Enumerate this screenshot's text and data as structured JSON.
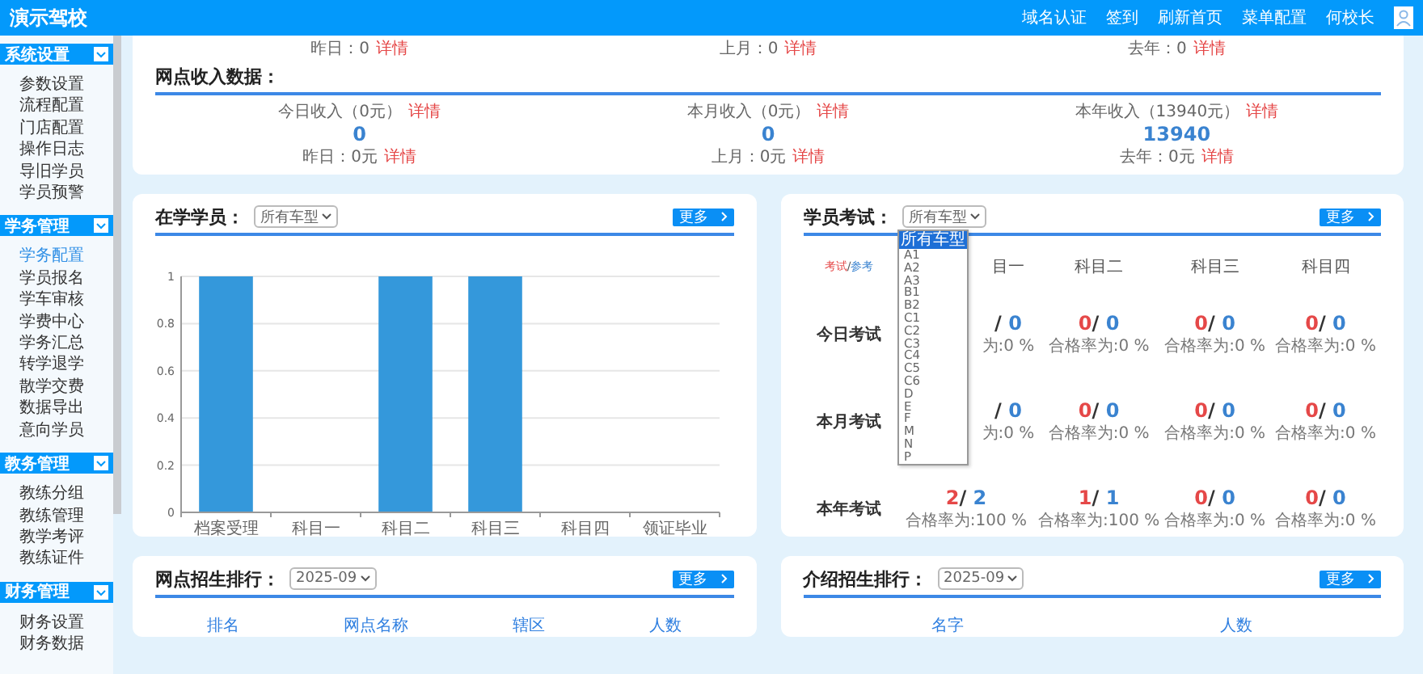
{
  "app": {
    "title": "演示驾校"
  },
  "top_nav": [
    {
      "label": "域名认证"
    },
    {
      "label": "签到"
    },
    {
      "label": "刷新首页"
    },
    {
      "label": "菜单配置"
    }
  ],
  "user": {
    "name": "何校长"
  },
  "sidebar": {
    "sections": [
      {
        "title": "系统设置",
        "expanded": true,
        "items": [
          {
            "label": "参数设置",
            "selected": false
          },
          {
            "label": "流程配置",
            "selected": false
          },
          {
            "label": "门店配置",
            "selected": false
          },
          {
            "label": "操作日志",
            "selected": false
          },
          {
            "label": "导旧学员",
            "selected": false
          },
          {
            "label": "学员预警",
            "selected": false
          }
        ]
      },
      {
        "title": "学务管理",
        "expanded": true,
        "items": [
          {
            "label": "学务配置",
            "selected": true
          },
          {
            "label": "学员报名",
            "selected": false
          },
          {
            "label": "学车审核",
            "selected": false
          },
          {
            "label": "学费中心",
            "selected": false
          },
          {
            "label": "学务汇总",
            "selected": false
          },
          {
            "label": "转学退学",
            "selected": false
          },
          {
            "label": "散学交费",
            "selected": false
          },
          {
            "label": "数据导出",
            "selected": false
          },
          {
            "label": "意向学员",
            "selected": false
          }
        ]
      },
      {
        "title": "教务管理",
        "expanded": true,
        "items": [
          {
            "label": "教练分组",
            "selected": false
          },
          {
            "label": "教练管理",
            "selected": false
          },
          {
            "label": "教学考评",
            "selected": false
          },
          {
            "label": "教练证件",
            "selected": false
          }
        ]
      },
      {
        "title": "财务管理",
        "expanded": true,
        "items": [
          {
            "label": "财务设置",
            "selected": false
          },
          {
            "label": "财务数据",
            "selected": false
          }
        ]
      }
    ]
  },
  "summary": {
    "prev_stats": [
      {
        "label": "昨日：0",
        "link": "详情"
      },
      {
        "label": "上月：0",
        "link": "详情"
      },
      {
        "label": "去年：0",
        "link": "详情"
      }
    ],
    "income": {
      "title": "网点收入数据：",
      "stats": [
        {
          "label": "今日收入（0元）",
          "link": "详情",
          "value": "0",
          "prev": "昨日：0元",
          "prev_link": "详情"
        },
        {
          "label": "本月收入（0元）",
          "link": "详情",
          "value": "0",
          "prev": "上月：0元",
          "prev_link": "详情"
        },
        {
          "label": "本年收入（13940元）",
          "link": "详情",
          "value": "13940",
          "prev": "去年：0元",
          "prev_link": "详情"
        }
      ]
    }
  },
  "students_card": {
    "title": "在学学员：",
    "filter": "所有车型",
    "more": "更多",
    "chart_data": {
      "type": "bar",
      "categories": [
        "档案受理",
        "科目一",
        "科目二",
        "科目三",
        "科目四",
        "领证毕业"
      ],
      "series": [
        {
          "color": "#3498db",
          "values": [
            1,
            0,
            1,
            1,
            0,
            0
          ]
        }
      ],
      "grid": true,
      "ylim": [
        0,
        1
      ],
      "yticks": [
        0,
        0.2,
        0.4,
        0.6,
        0.8,
        1
      ]
    }
  },
  "exam_card": {
    "title": "学员考试：",
    "filter": "所有车型",
    "more": "更多",
    "dropdown": {
      "options": [
        {
          "label": "所有车型",
          "selected": true
        },
        {
          "label": "A1",
          "selected": false
        },
        {
          "label": "A2",
          "selected": false
        },
        {
          "label": "A3",
          "selected": false
        },
        {
          "label": "B1",
          "selected": false
        },
        {
          "label": "B2",
          "selected": false
        },
        {
          "label": "C1",
          "selected": false
        },
        {
          "label": "C2",
          "selected": false
        },
        {
          "label": "C3",
          "selected": false
        },
        {
          "label": "C4",
          "selected": false
        },
        {
          "label": "C5",
          "selected": false
        },
        {
          "label": "C6",
          "selected": false
        },
        {
          "label": "D",
          "selected": false
        },
        {
          "label": "E",
          "selected": false
        },
        {
          "label": "F",
          "selected": false
        },
        {
          "label": "M",
          "selected": false
        },
        {
          "label": "N",
          "selected": false
        },
        {
          "label": "P",
          "selected": false
        }
      ]
    },
    "legend": {
      "exam": "考试",
      "separator": "/",
      "reference": "参考"
    },
    "subjects": [
      "目一",
      "科目二",
      "科目三",
      "科目四"
    ],
    "rows": [
      {
        "label": "今日考试",
        "cells": [
          {
            "separator": "/",
            "total": "0",
            "rate": "为:0 %"
          },
          {
            "passed": "0",
            "separator": "/",
            "total": "0",
            "rate": "合格率为:0 %"
          },
          {
            "passed": "0",
            "separator": "/",
            "total": "0",
            "rate": "合格率为:0 %"
          },
          {
            "passed": "0",
            "separator": "/",
            "total": "0",
            "rate": "合格率为:0 %"
          }
        ]
      },
      {
        "label": "本月考试",
        "cells": [
          {
            "separator": "/",
            "total": "0",
            "rate": "为:0 %"
          },
          {
            "passed": "0",
            "separator": "/",
            "total": "0",
            "rate": "合格率为:0 %"
          },
          {
            "passed": "0",
            "separator": "/",
            "total": "0",
            "rate": "合格率为:0 %"
          },
          {
            "passed": "0",
            "separator": "/",
            "total": "0",
            "rate": "合格率为:0 %"
          }
        ]
      },
      {
        "label": "本年考试",
        "cells": [
          {
            "passed": "2",
            "separator": "/",
            "total": "2",
            "rate": "合格率为:100 %"
          },
          {
            "passed": "1",
            "separator": "/",
            "total": "1",
            "rate": "合格率为:100 %"
          },
          {
            "passed": "0",
            "separator": "/",
            "total": "0",
            "rate": "合格率为:0 %"
          },
          {
            "passed": "0",
            "separator": "/",
            "total": "0",
            "rate": "合格率为:0 %"
          }
        ]
      }
    ]
  },
  "ranking_cards": [
    {
      "title": "网点招生排行：",
      "filter": "2025-09",
      "more": "更多",
      "columns": [
        "排名",
        "网点名称",
        "辖区",
        "人数"
      ]
    },
    {
      "title": "介绍招生排行：",
      "filter": "2025-09",
      "more": "更多",
      "columns": [
        "名字",
        "人数"
      ]
    }
  ]
}
